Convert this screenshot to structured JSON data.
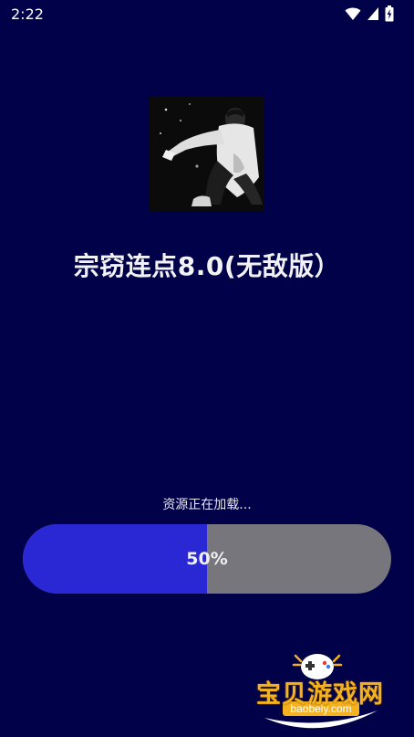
{
  "status_bar": {
    "time": "2:22",
    "icons": [
      "wifi-icon",
      "cellular-signal-icon",
      "battery-charging-icon"
    ]
  },
  "app": {
    "title": "宗窃连点8.0(无敌版）",
    "cover_image": "cover-photo"
  },
  "loading": {
    "message": "资源正在加载...",
    "progress_label": "50%",
    "progress_fraction": 0.5
  },
  "watermark": {
    "brand_text": "宝贝游戏网",
    "domain_text": "baobeiy.com"
  },
  "colors": {
    "background": "#01014a",
    "progress_fill": "#2a28d4",
    "progress_track": "#76767c",
    "watermark_gold": "#f5b21f"
  }
}
